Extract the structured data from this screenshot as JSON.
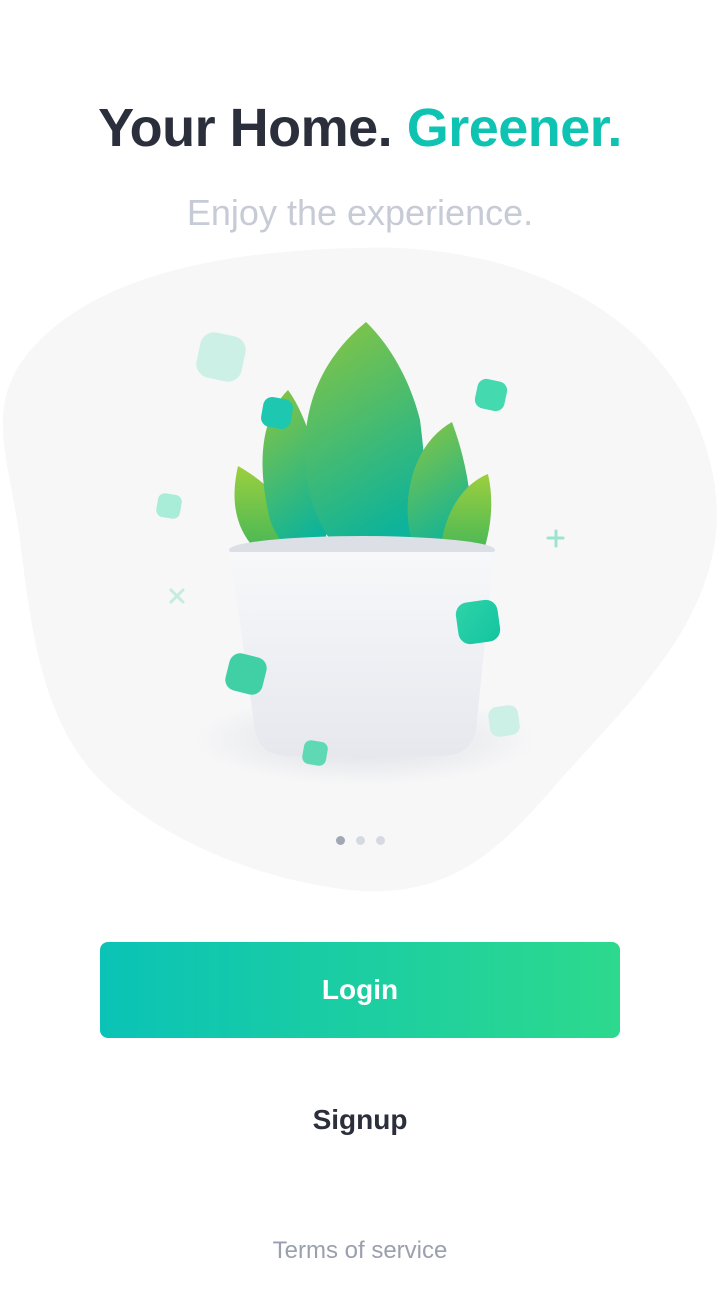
{
  "headline": {
    "part1": "Your Home.",
    "part2": "Greener."
  },
  "subtitle": "Enjoy the experience.",
  "carousel": {
    "pages": 3,
    "active_page": 1
  },
  "buttons": {
    "login": "Login",
    "signup": "Signup"
  },
  "footer": {
    "terms": "Terms of service"
  },
  "colors": {
    "text_dark": "#2b2e3b",
    "accent": "#0ec3b2",
    "subtitle": "#c7cbd6",
    "gradient_start": "#0ac3b6",
    "gradient_end": "#2dd98d",
    "blob": "#f7f7f8"
  }
}
